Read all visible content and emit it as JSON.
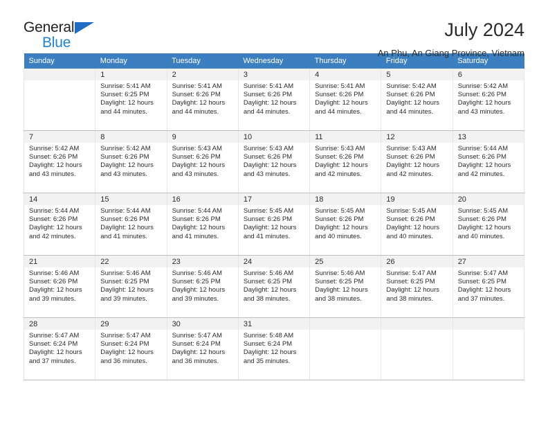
{
  "brand": {
    "name_top": "General",
    "name_bottom": "Blue",
    "triangle_color": "#1f6ec4",
    "blue_color": "#1f83d4"
  },
  "header": {
    "month_title": "July 2024",
    "location": "An Phu, An Giang Province, Vietnam"
  },
  "theme": {
    "header_bg": "#3c7fc0",
    "daynum_bg": "#f2f2f2",
    "grid_line": "#bfbfbf",
    "text": "#2b2b2b"
  },
  "calendar": {
    "weekday_headers": [
      "Sunday",
      "Monday",
      "Tuesday",
      "Wednesday",
      "Thursday",
      "Friday",
      "Saturday"
    ],
    "weeks": [
      [
        {
          "day": "",
          "empty": true
        },
        {
          "day": "1",
          "sunrise": "Sunrise: 5:41 AM",
          "sunset": "Sunset: 6:25 PM",
          "daylight": "Daylight: 12 hours and 44 minutes."
        },
        {
          "day": "2",
          "sunrise": "Sunrise: 5:41 AM",
          "sunset": "Sunset: 6:26 PM",
          "daylight": "Daylight: 12 hours and 44 minutes."
        },
        {
          "day": "3",
          "sunrise": "Sunrise: 5:41 AM",
          "sunset": "Sunset: 6:26 PM",
          "daylight": "Daylight: 12 hours and 44 minutes."
        },
        {
          "day": "4",
          "sunrise": "Sunrise: 5:41 AM",
          "sunset": "Sunset: 6:26 PM",
          "daylight": "Daylight: 12 hours and 44 minutes."
        },
        {
          "day": "5",
          "sunrise": "Sunrise: 5:42 AM",
          "sunset": "Sunset: 6:26 PM",
          "daylight": "Daylight: 12 hours and 44 minutes."
        },
        {
          "day": "6",
          "sunrise": "Sunrise: 5:42 AM",
          "sunset": "Sunset: 6:26 PM",
          "daylight": "Daylight: 12 hours and 43 minutes."
        }
      ],
      [
        {
          "day": "7",
          "sunrise": "Sunrise: 5:42 AM",
          "sunset": "Sunset: 6:26 PM",
          "daylight": "Daylight: 12 hours and 43 minutes."
        },
        {
          "day": "8",
          "sunrise": "Sunrise: 5:42 AM",
          "sunset": "Sunset: 6:26 PM",
          "daylight": "Daylight: 12 hours and 43 minutes."
        },
        {
          "day": "9",
          "sunrise": "Sunrise: 5:43 AM",
          "sunset": "Sunset: 6:26 PM",
          "daylight": "Daylight: 12 hours and 43 minutes."
        },
        {
          "day": "10",
          "sunrise": "Sunrise: 5:43 AM",
          "sunset": "Sunset: 6:26 PM",
          "daylight": "Daylight: 12 hours and 43 minutes."
        },
        {
          "day": "11",
          "sunrise": "Sunrise: 5:43 AM",
          "sunset": "Sunset: 6:26 PM",
          "daylight": "Daylight: 12 hours and 42 minutes."
        },
        {
          "day": "12",
          "sunrise": "Sunrise: 5:43 AM",
          "sunset": "Sunset: 6:26 PM",
          "daylight": "Daylight: 12 hours and 42 minutes."
        },
        {
          "day": "13",
          "sunrise": "Sunrise: 5:44 AM",
          "sunset": "Sunset: 6:26 PM",
          "daylight": "Daylight: 12 hours and 42 minutes."
        }
      ],
      [
        {
          "day": "14",
          "sunrise": "Sunrise: 5:44 AM",
          "sunset": "Sunset: 6:26 PM",
          "daylight": "Daylight: 12 hours and 42 minutes."
        },
        {
          "day": "15",
          "sunrise": "Sunrise: 5:44 AM",
          "sunset": "Sunset: 6:26 PM",
          "daylight": "Daylight: 12 hours and 41 minutes."
        },
        {
          "day": "16",
          "sunrise": "Sunrise: 5:44 AM",
          "sunset": "Sunset: 6:26 PM",
          "daylight": "Daylight: 12 hours and 41 minutes."
        },
        {
          "day": "17",
          "sunrise": "Sunrise: 5:45 AM",
          "sunset": "Sunset: 6:26 PM",
          "daylight": "Daylight: 12 hours and 41 minutes."
        },
        {
          "day": "18",
          "sunrise": "Sunrise: 5:45 AM",
          "sunset": "Sunset: 6:26 PM",
          "daylight": "Daylight: 12 hours and 40 minutes."
        },
        {
          "day": "19",
          "sunrise": "Sunrise: 5:45 AM",
          "sunset": "Sunset: 6:26 PM",
          "daylight": "Daylight: 12 hours and 40 minutes."
        },
        {
          "day": "20",
          "sunrise": "Sunrise: 5:45 AM",
          "sunset": "Sunset: 6:26 PM",
          "daylight": "Daylight: 12 hours and 40 minutes."
        }
      ],
      [
        {
          "day": "21",
          "sunrise": "Sunrise: 5:46 AM",
          "sunset": "Sunset: 6:26 PM",
          "daylight": "Daylight: 12 hours and 39 minutes."
        },
        {
          "day": "22",
          "sunrise": "Sunrise: 5:46 AM",
          "sunset": "Sunset: 6:25 PM",
          "daylight": "Daylight: 12 hours and 39 minutes."
        },
        {
          "day": "23",
          "sunrise": "Sunrise: 5:46 AM",
          "sunset": "Sunset: 6:25 PM",
          "daylight": "Daylight: 12 hours and 39 minutes."
        },
        {
          "day": "24",
          "sunrise": "Sunrise: 5:46 AM",
          "sunset": "Sunset: 6:25 PM",
          "daylight": "Daylight: 12 hours and 38 minutes."
        },
        {
          "day": "25",
          "sunrise": "Sunrise: 5:46 AM",
          "sunset": "Sunset: 6:25 PM",
          "daylight": "Daylight: 12 hours and 38 minutes."
        },
        {
          "day": "26",
          "sunrise": "Sunrise: 5:47 AM",
          "sunset": "Sunset: 6:25 PM",
          "daylight": "Daylight: 12 hours and 38 minutes."
        },
        {
          "day": "27",
          "sunrise": "Sunrise: 5:47 AM",
          "sunset": "Sunset: 6:25 PM",
          "daylight": "Daylight: 12 hours and 37 minutes."
        }
      ],
      [
        {
          "day": "28",
          "sunrise": "Sunrise: 5:47 AM",
          "sunset": "Sunset: 6:24 PM",
          "daylight": "Daylight: 12 hours and 37 minutes."
        },
        {
          "day": "29",
          "sunrise": "Sunrise: 5:47 AM",
          "sunset": "Sunset: 6:24 PM",
          "daylight": "Daylight: 12 hours and 36 minutes."
        },
        {
          "day": "30",
          "sunrise": "Sunrise: 5:47 AM",
          "sunset": "Sunset: 6:24 PM",
          "daylight": "Daylight: 12 hours and 36 minutes."
        },
        {
          "day": "31",
          "sunrise": "Sunrise: 5:48 AM",
          "sunset": "Sunset: 6:24 PM",
          "daylight": "Daylight: 12 hours and 35 minutes."
        },
        {
          "day": "",
          "blank": true
        },
        {
          "day": "",
          "blank": true
        },
        {
          "day": "",
          "blank": true
        }
      ]
    ]
  }
}
